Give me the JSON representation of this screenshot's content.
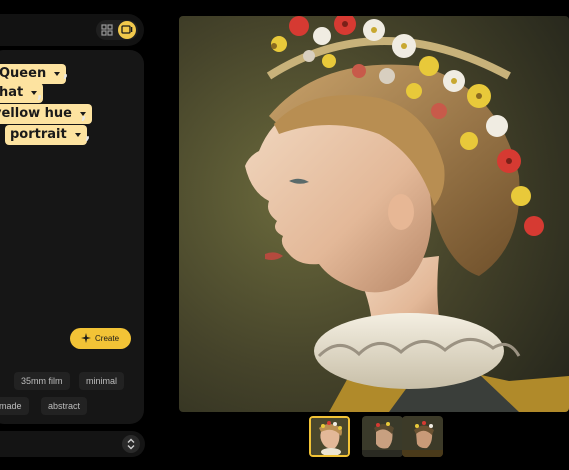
{
  "header": {
    "view_toggle": {
      "grid_icon": "grid-icon",
      "single_icon": "single-view-icon",
      "active": "single"
    }
  },
  "prompt": {
    "chips": [
      {
        "label": "Queen"
      },
      {
        "label": "hat"
      },
      {
        "label": "yellow hue"
      },
      {
        "label": "portrait"
      }
    ],
    "separator": ",",
    "create_label": "Create"
  },
  "tags": {
    "row1": [
      "35mm film",
      "minimal"
    ],
    "row2": [
      "handmade",
      "abstract"
    ]
  },
  "gallery": {
    "selected_index": 0,
    "thumbnail_count": 3
  },
  "colors": {
    "accent": "#f2c336",
    "chip_bg": "#fde3a0",
    "panel_bg": "#161616"
  }
}
